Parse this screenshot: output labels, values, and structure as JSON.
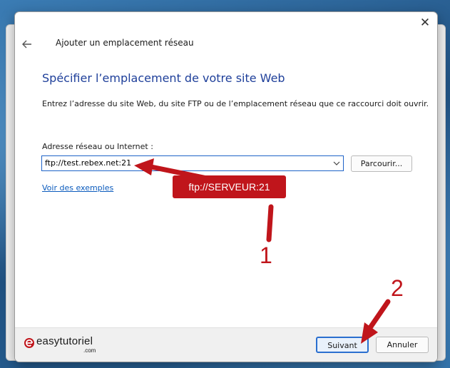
{
  "dialog": {
    "title": "Ajouter un emplacement réseau",
    "heading": "Spécifier l’emplacement de votre site Web",
    "description": "Entrez l’adresse du site Web, du site FTP ou de l’emplacement réseau que ce raccourci doit ouvrir.",
    "field_label": "Adresse réseau ou Internet :",
    "address_value": "ftp://test.rebex.net:21",
    "browse_label": "Parcourir...",
    "examples_link": "Voir des exemples",
    "close_glyph": "✕"
  },
  "footer": {
    "next_label": "Suivant",
    "cancel_label": "Annuler"
  },
  "annotation": {
    "box_text": "ftp://SERVEUR:21",
    "step1": "1",
    "step2": "2",
    "color": "#c0151b"
  },
  "watermark": {
    "name": "easytutoriel",
    "suffix": ".com"
  },
  "icons": [
    "close-icon",
    "back-arrow-icon",
    "chevron-down-icon",
    "logo-e-icon"
  ]
}
